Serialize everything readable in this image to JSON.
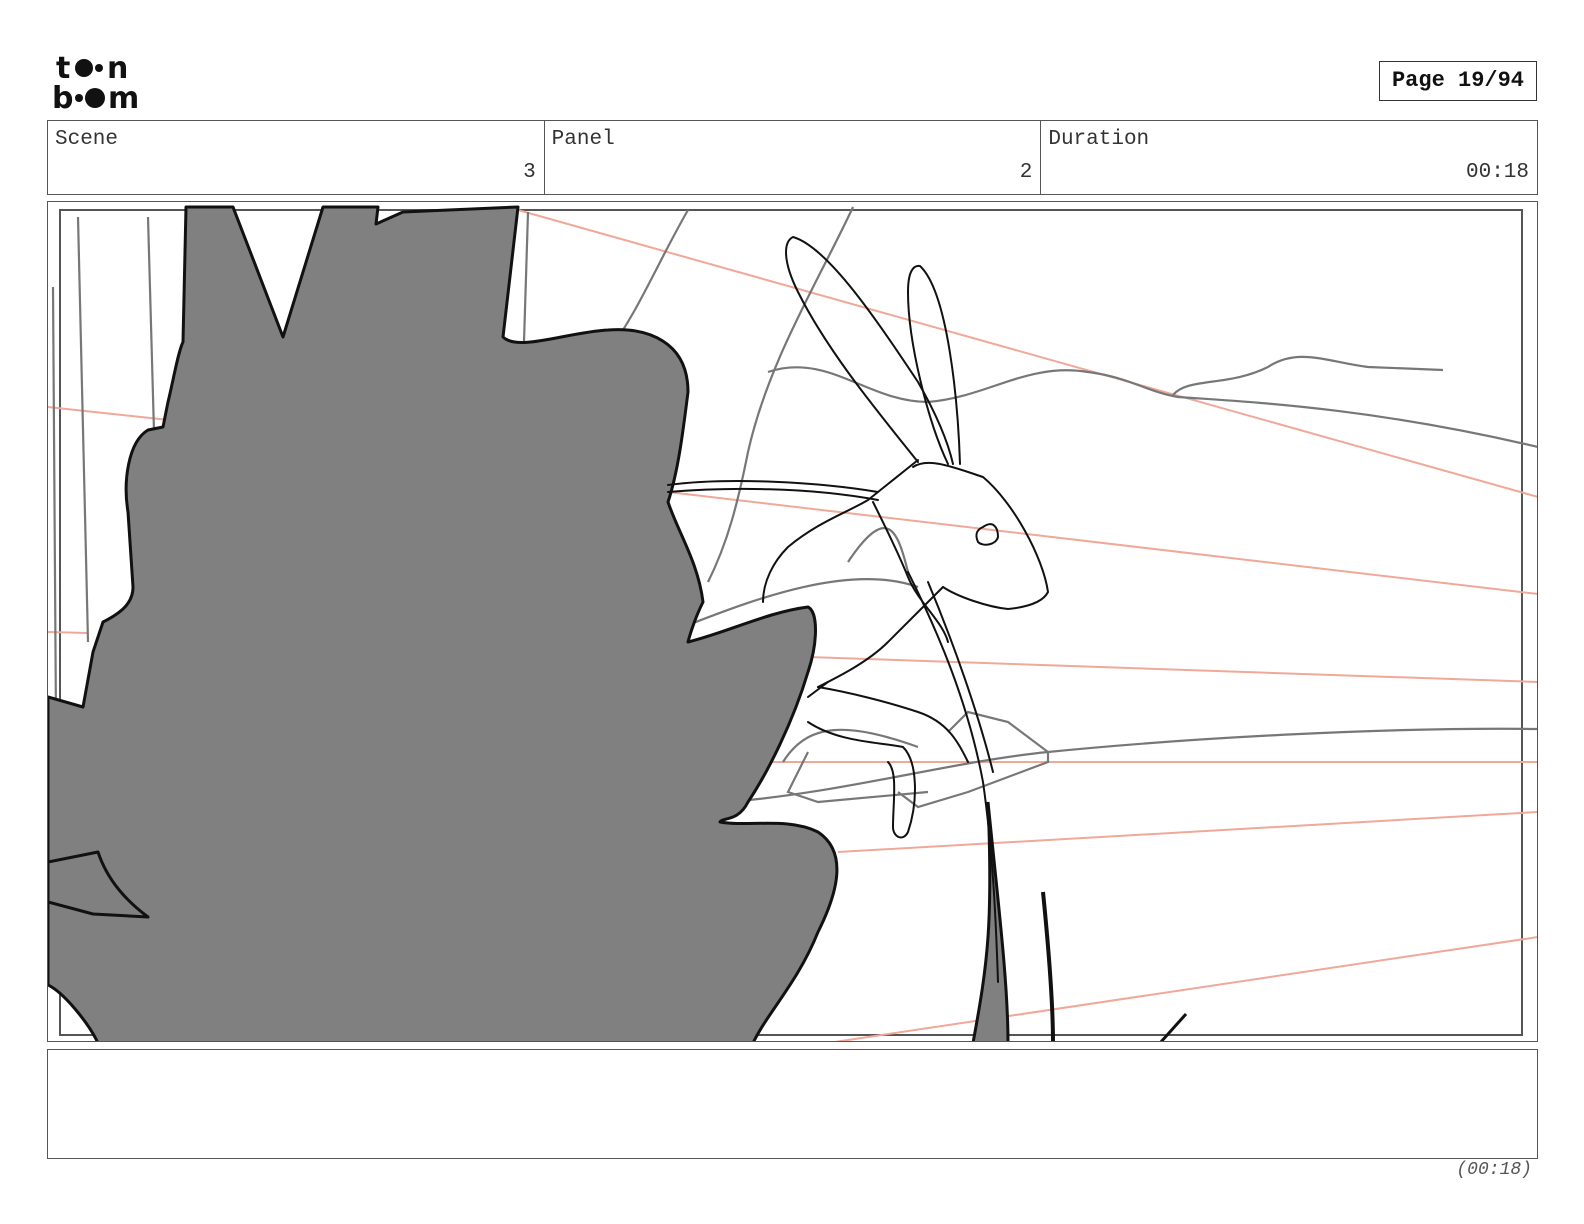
{
  "header": {
    "logo_text": "toonboom",
    "page_label": "Page 19/94"
  },
  "info": {
    "scene_label": "Scene",
    "scene_value": "3",
    "panel_label": "Panel",
    "panel_value": "2",
    "duration_label": "Duration",
    "duration_value": "00:18"
  },
  "notes": {
    "text": ""
  },
  "footer": {
    "duration": "(00:18)"
  },
  "colors": {
    "foliage_fill": "#808080",
    "guide_lines": "#f0a898",
    "sketch_lines": "#777777",
    "ink_lines": "#111111"
  }
}
